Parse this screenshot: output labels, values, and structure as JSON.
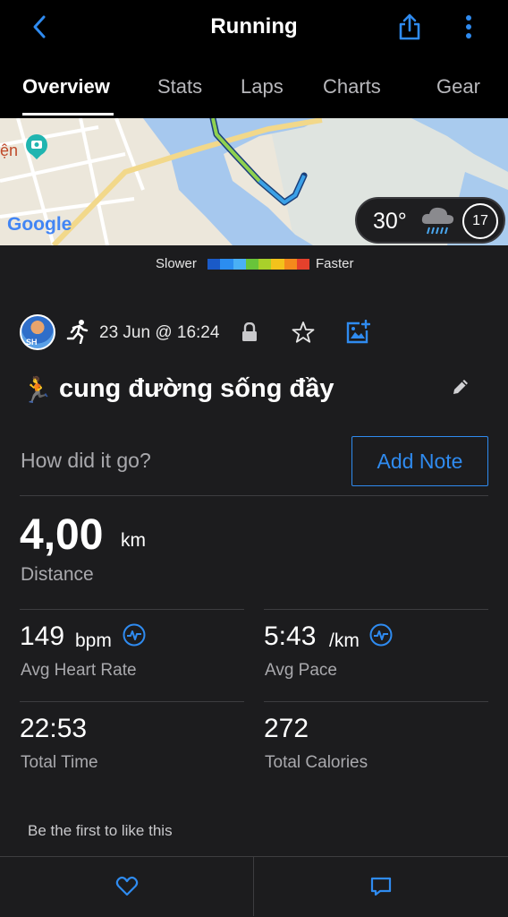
{
  "header": {
    "title": "Running",
    "back_icon": "chevron-left-icon",
    "share_icon": "share-icon",
    "more_icon": "more-vertical-icon",
    "accent": "#2f8bf0"
  },
  "tabs": [
    {
      "label": "Overview",
      "active": true
    },
    {
      "label": "Stats",
      "active": false
    },
    {
      "label": "Laps",
      "active": false
    },
    {
      "label": "Charts",
      "active": false
    },
    {
      "label": "Gear",
      "active": false
    }
  ],
  "map": {
    "brand": "Google",
    "place_fragment_left": "ện",
    "weather": {
      "temp": "30°",
      "icon": "rain-cloud-icon",
      "badge": "17"
    }
  },
  "pace_legend": {
    "slower": "Slower",
    "faster": "Faster",
    "colors": [
      "#1a5ac7",
      "#2b8df0",
      "#4ab0f5",
      "#68c43a",
      "#a9d02a",
      "#f3c21b",
      "#f48a1c",
      "#e5412c"
    ]
  },
  "activity": {
    "avatar_initials": "SH",
    "date": "23 Jun @ 16:24",
    "emoji": "🏃",
    "name": "cung đường sống đầy"
  },
  "note": {
    "prompt": "How did it go?",
    "button": "Add Note"
  },
  "distance": {
    "value": "4,00",
    "unit": "km",
    "label": "Distance"
  },
  "stats": [
    {
      "value": "149",
      "unit": "bpm",
      "label": "Avg Heart Rate",
      "icon": "heart-rate-icon"
    },
    {
      "value": "5:43",
      "unit": "/km",
      "label": "Avg Pace",
      "icon": "heart-rate-icon"
    },
    {
      "value": "22:53",
      "unit": "",
      "label": "Total Time"
    },
    {
      "value": "272",
      "unit": "",
      "label": "Total Calories"
    }
  ],
  "social": {
    "likes_text": "Be the first to like this",
    "like_icon": "heart-icon",
    "comment_icon": "comment-icon"
  }
}
